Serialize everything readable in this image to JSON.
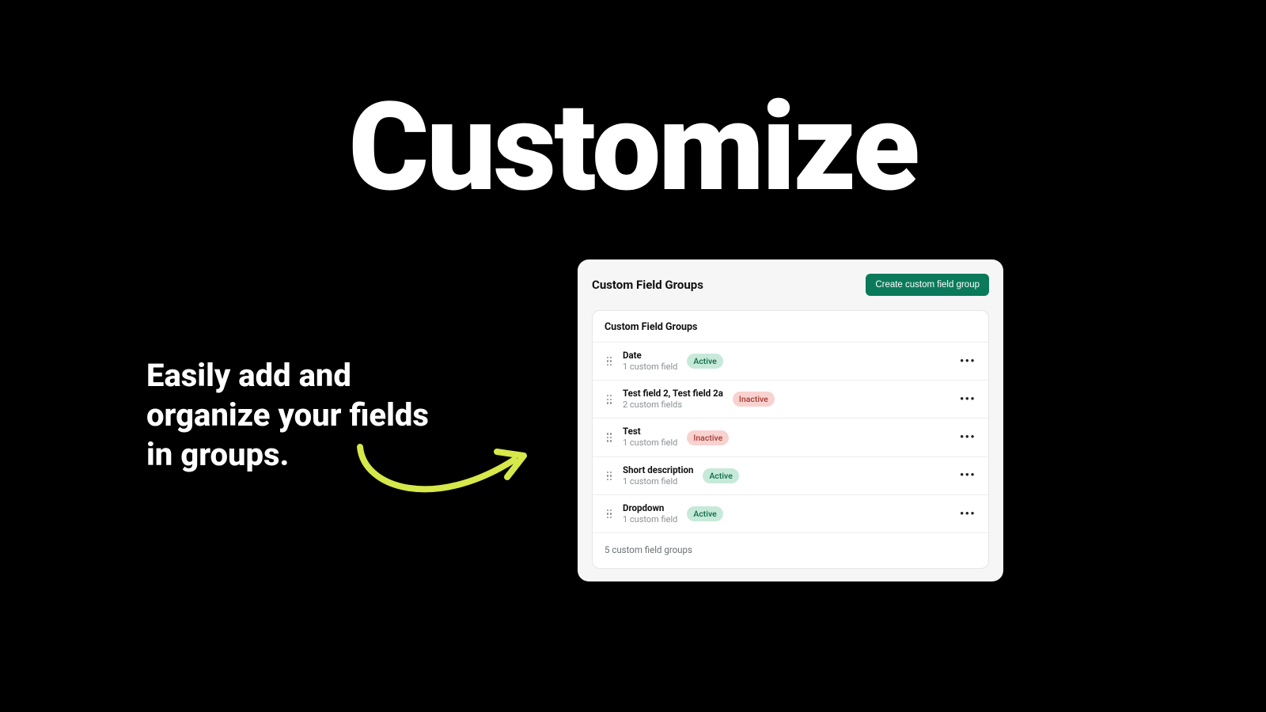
{
  "hero": {
    "title": "Customize",
    "subhead": "Easily add and organize your fields in groups."
  },
  "panel": {
    "title": "Custom Field Groups",
    "create_button": "Create custom field group",
    "card_header": "Custom Field Groups",
    "footer": "5 custom field groups",
    "rows": [
      {
        "title": "Date",
        "sub": "1 custom field",
        "status": "Active",
        "status_kind": "active"
      },
      {
        "title": "Test field 2, Test field 2a",
        "sub": "2 custom fields",
        "status": "Inactive",
        "status_kind": "inactive"
      },
      {
        "title": "Test",
        "sub": "1 custom field",
        "status": "Inactive",
        "status_kind": "inactive"
      },
      {
        "title": "Short description",
        "sub": "1 custom field",
        "status": "Active",
        "status_kind": "active"
      },
      {
        "title": "Dropdown",
        "sub": "1 custom field",
        "status": "Active",
        "status_kind": "active"
      }
    ]
  },
  "colors": {
    "accent_green": "#0b7a5a",
    "badge_active_bg": "#c7e9d9",
    "badge_inactive_bg": "#f8d2cf",
    "arrow": "#d6e84a"
  }
}
